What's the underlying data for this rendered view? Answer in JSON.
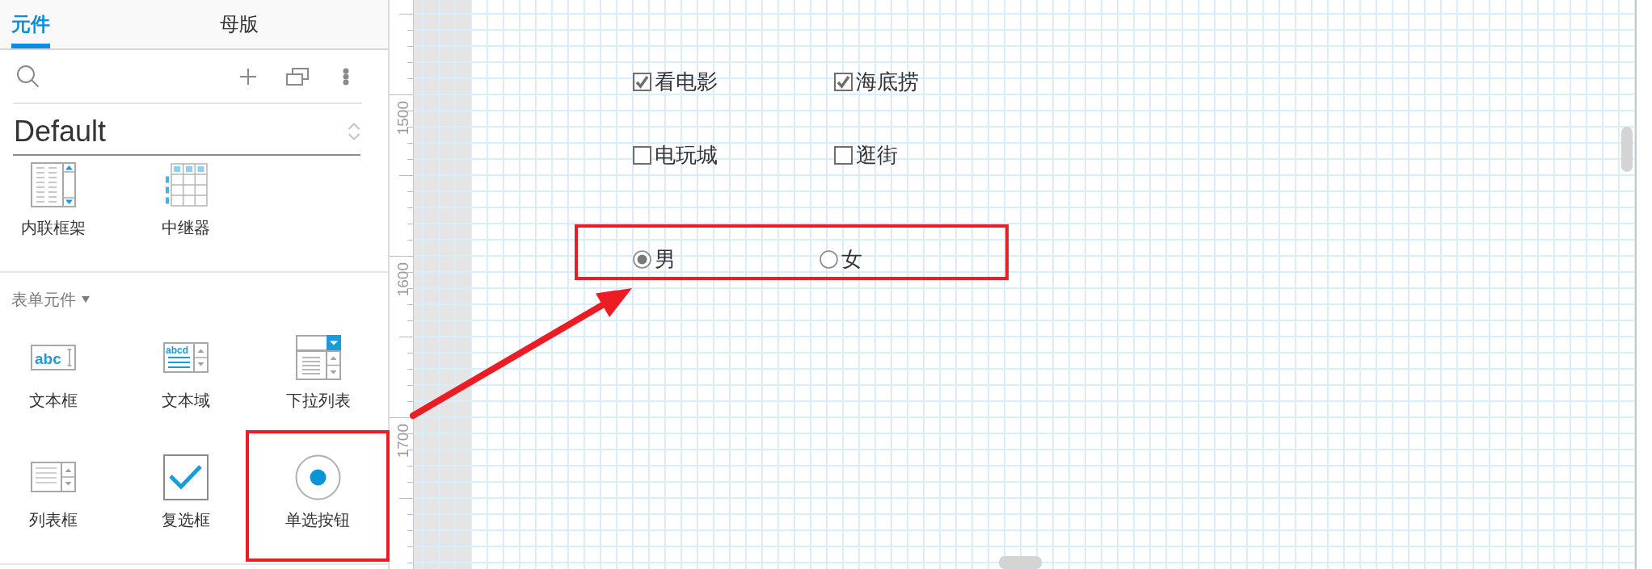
{
  "panel": {
    "tabs": [
      {
        "label": "元件",
        "selected": true
      },
      {
        "label": "母版",
        "selected": false
      }
    ],
    "library": {
      "value": "Default"
    },
    "sections": [
      {
        "items": [
          {
            "label": "内联框架",
            "kind": "inline-frame",
            "highlighted": false
          },
          {
            "label": "中继器",
            "kind": "repeater",
            "highlighted": false
          }
        ]
      },
      {
        "title": "表单元件",
        "expanded": true,
        "items": [
          {
            "label": "文本框",
            "kind": "text-field",
            "icon_text": "abc",
            "highlighted": false
          },
          {
            "label": "文本域",
            "kind": "text-area",
            "icon_text": "abcd",
            "highlighted": false
          },
          {
            "label": "下拉列表",
            "kind": "droplist",
            "highlighted": false
          },
          {
            "label": "列表框",
            "kind": "list-box",
            "highlighted": false
          },
          {
            "label": "复选框",
            "kind": "checkbox",
            "highlighted": false
          },
          {
            "label": "单选按钮",
            "kind": "radio-button",
            "highlighted": true
          }
        ]
      }
    ]
  },
  "canvas": {
    "ruler_labels": [
      "1500",
      "1600",
      "1700"
    ],
    "checkbox_rows": [
      [
        {
          "label": "看电影",
          "checked": true
        },
        {
          "label": "海底捞",
          "checked": true
        }
      ],
      [
        {
          "label": "电玩城",
          "checked": false
        },
        {
          "label": "逛街",
          "checked": false
        }
      ]
    ],
    "radio_group": {
      "highlighted": true,
      "options": [
        {
          "label": "男",
          "selected": true
        },
        {
          "label": "女",
          "selected": false
        }
      ]
    }
  },
  "annotation_arrow": true
}
